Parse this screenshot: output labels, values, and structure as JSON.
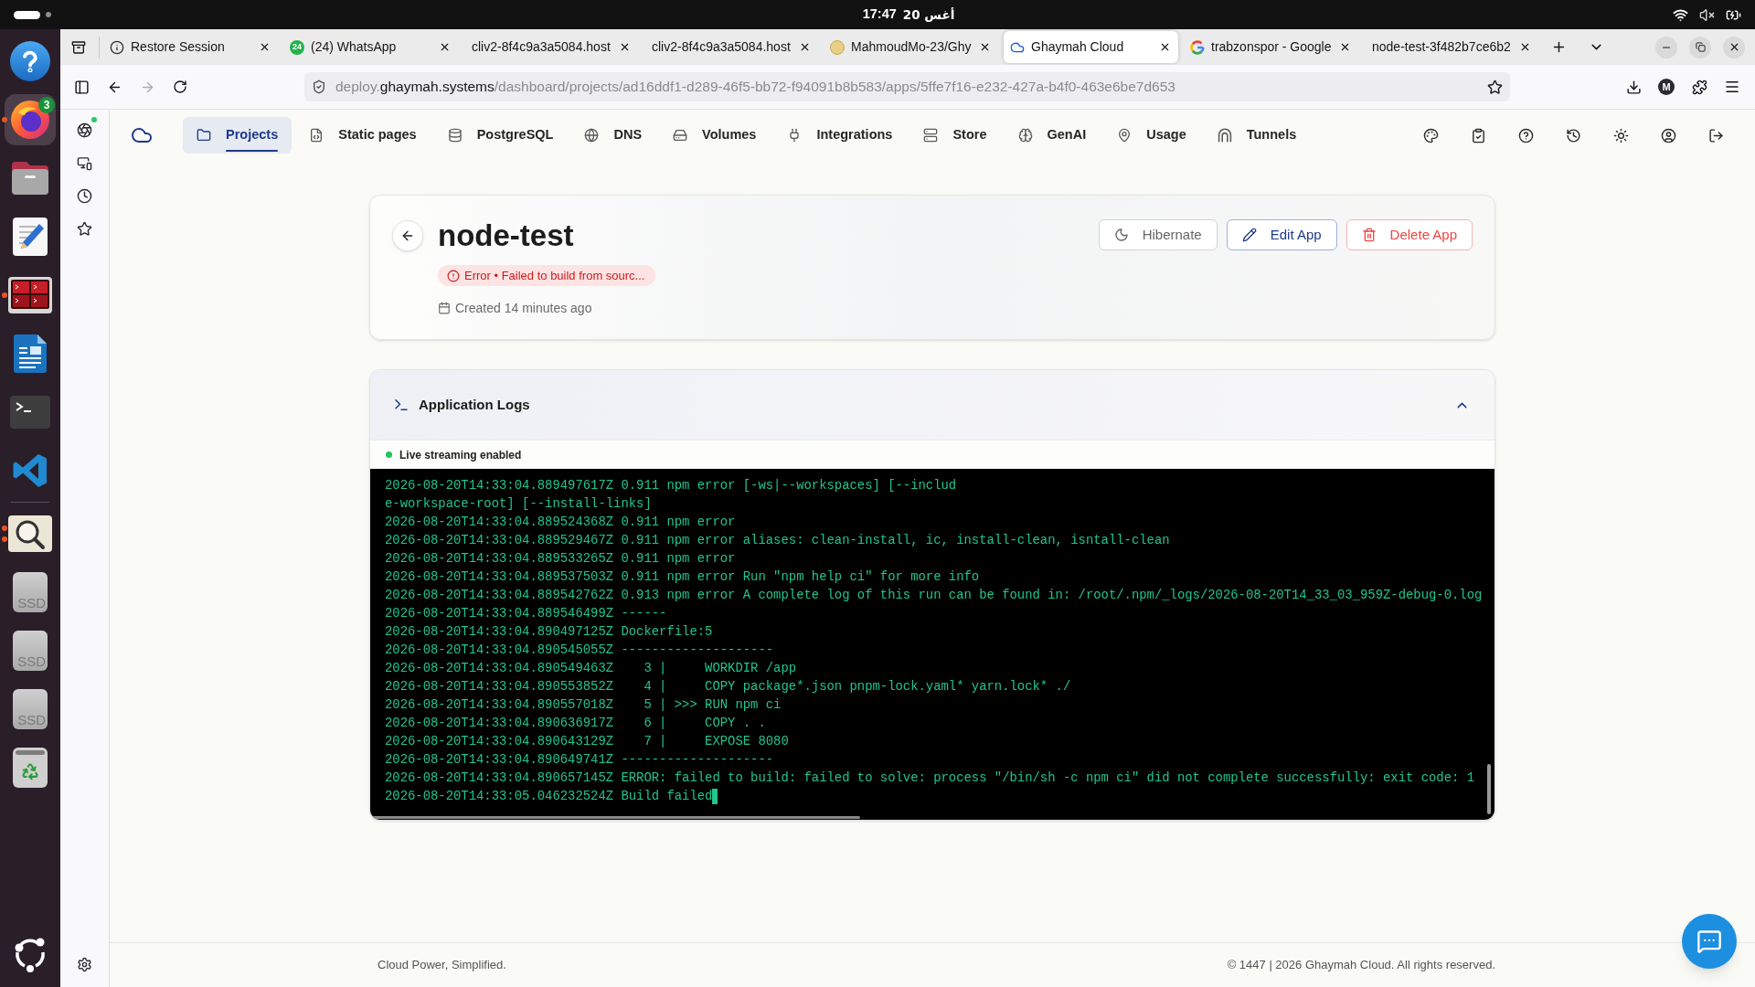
{
  "system_bar": {
    "time": "17:47",
    "date": "20 أغس"
  },
  "dock": {
    "apps": [
      {
        "kind": "help",
        "focused": false,
        "running": false
      },
      {
        "kind": "browser",
        "focused": true,
        "running": true,
        "badge": "3"
      },
      {
        "kind": "files",
        "focused": false,
        "running": false
      },
      {
        "kind": "text-editor",
        "focused": false,
        "running": false
      },
      {
        "kind": "terminal-grid",
        "focused": false,
        "running": true
      },
      {
        "kind": "writer",
        "focused": false,
        "running": false
      },
      {
        "kind": "terminal",
        "focused": false,
        "running": false
      },
      {
        "kind": "code-editor",
        "focused": false,
        "running": false
      }
    ],
    "devices": [
      {
        "kind": "image-viewer",
        "focused": false,
        "running": true,
        "multi_window": true
      },
      {
        "kind": "drive",
        "label": "SSD",
        "focused": false,
        "running": false
      },
      {
        "kind": "drive",
        "label": "SSD",
        "focused": false,
        "running": false
      },
      {
        "kind": "drive",
        "label": "SSD",
        "focused": false,
        "running": false
      },
      {
        "kind": "trash",
        "focused": false,
        "running": false
      }
    ]
  },
  "browser": {
    "tabs": [
      {
        "title": "Restore Session",
        "kind": "info",
        "selected": false
      },
      {
        "title": "(24) WhatsApp",
        "kind": "count",
        "badge": "24",
        "selected": false
      },
      {
        "title": "cliv2-8f4c9a3a5084.host",
        "kind": "plain",
        "selected": false
      },
      {
        "title": "cliv2-8f4c9a3a5084.host",
        "kind": "plain",
        "selected": false
      },
      {
        "title": "MahmoudMo-23/Ghy",
        "kind": "avatar",
        "selected": false
      },
      {
        "title": "Ghaymah Cloud",
        "kind": "cloud",
        "selected": true
      },
      {
        "title": "trabzonspor - Google",
        "kind": "ring",
        "selected": false
      },
      {
        "title": "node-test-3f482b7ce6b2",
        "kind": "plain",
        "selected": false
      }
    ],
    "forward_disabled": true,
    "address": {
      "prefix": "deploy.",
      "domain": "ghaymah.systems",
      "path": "/dashboard/projects/ad16ddf1-d289-46f5-bb72-f94091b8b583/apps/5ffe7f16-e232-427a-b4f0-463e6be7d653"
    },
    "profile_initial": "M",
    "sidebar": [
      {
        "kind": "assistant",
        "notification": true
      },
      {
        "kind": "devices",
        "notification": false
      },
      {
        "kind": "history",
        "notification": false
      },
      {
        "kind": "bookmarks",
        "notification": false
      }
    ]
  },
  "page": {
    "nav": {
      "items": [
        {
          "label": "Projects",
          "selected": true
        },
        {
          "label": "Static pages",
          "selected": false
        },
        {
          "label": "PostgreSQL",
          "selected": false
        },
        {
          "label": "DNS",
          "selected": false
        },
        {
          "label": "Volumes",
          "selected": false
        },
        {
          "label": "Integrations",
          "selected": false
        },
        {
          "label": "Store",
          "selected": false
        },
        {
          "label": "GenAI",
          "selected": false
        },
        {
          "label": "Usage",
          "selected": false
        },
        {
          "label": "Tunnels",
          "selected": false
        }
      ],
      "actions": [
        {
          "kind": "palette"
        },
        {
          "kind": "checklist"
        },
        {
          "kind": "help"
        },
        {
          "kind": "history"
        },
        {
          "kind": "theme"
        },
        {
          "kind": "account"
        },
        {
          "kind": "logout"
        }
      ]
    },
    "app": {
      "name": "node-test",
      "status": {
        "kind": "error",
        "text": "Error • Failed to build from sourc..."
      },
      "created": "Created 14 minutes ago",
      "actions": [
        {
          "label": "Hibernate",
          "kind": "neutral"
        },
        {
          "label": "Edit App",
          "kind": "primary"
        },
        {
          "label": "Delete App",
          "kind": "danger"
        }
      ]
    },
    "logs": {
      "title": "Application Logs",
      "expanded": true,
      "streaming": {
        "on": true,
        "label": "Live streaming enabled"
      },
      "cursor": true,
      "lines": [
        "2026-08-20T14:33:04.889497617Z 0.911 npm error [-ws|--workspaces] [--includ",
        "e-workspace-root] [--install-links]",
        "2026-08-20T14:33:04.889524368Z 0.911 npm error",
        "2026-08-20T14:33:04.889529467Z 0.911 npm error aliases: clean-install, ic, install-clean, isntall-clean",
        "2026-08-20T14:33:04.889533265Z 0.911 npm error",
        "2026-08-20T14:33:04.889537503Z 0.911 npm error Run \"npm help ci\" for more info",
        "2026-08-20T14:33:04.889542762Z 0.913 npm error A complete log of this run can be found in: /root/.npm/_logs/2026-08-20T14_33_03_959Z-debug-0.log",
        "2026-08-20T14:33:04.889546499Z ------",
        "2026-08-20T14:33:04.890497125Z Dockerfile:5",
        "2026-08-20T14:33:04.890545055Z --------------------",
        "2026-08-20T14:33:04.890549463Z    3 |     WORKDIR /app",
        "2026-08-20T14:33:04.890553852Z    4 |     COPY package*.json pnpm-lock.yaml* yarn.lock* ./",
        "2026-08-20T14:33:04.890557018Z    5 | >>> RUN npm ci",
        "2026-08-20T14:33:04.890636917Z    6 |     COPY . .",
        "2026-08-20T14:33:04.890643129Z    7 |     EXPOSE 8080",
        "2026-08-20T14:33:04.890649741Z --------------------",
        "2026-08-20T14:33:04.890657145Z ERROR: failed to build: failed to solve: process \"/bin/sh -c npm ci\" did not complete successfully: exit code: 1",
        "2026-08-20T14:33:05.046232524Z Build failed"
      ]
    },
    "footer": {
      "tagline": "Cloud Power, Simplified.",
      "copyright": "© 1447 | 2026 Ghaymah Cloud. All rights reserved."
    }
  }
}
